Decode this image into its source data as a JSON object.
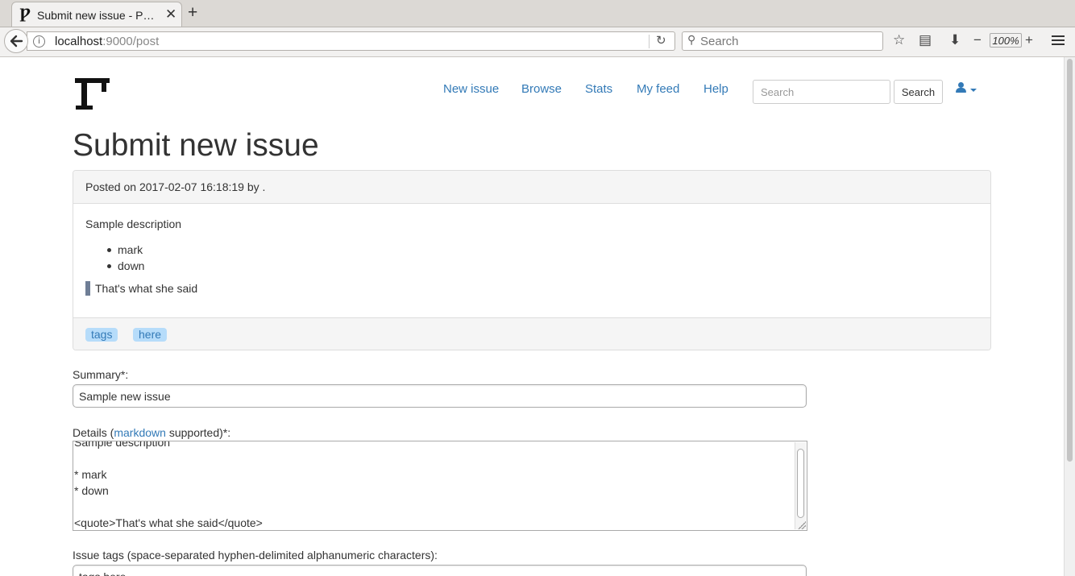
{
  "browser": {
    "tab_title": "Submit new issue - P…",
    "tab_favicon": "Ƿ",
    "url_host": "localhost",
    "url_rest": ":9000/post",
    "search_placeholder": "Search",
    "zoom": "100%"
  },
  "header": {
    "nav": [
      "New issue",
      "Browse",
      "Stats",
      "My feed",
      "Help"
    ],
    "search_placeholder": "Search",
    "search_button": "Search"
  },
  "page": {
    "title": "Submit new issue"
  },
  "preview": {
    "posted": "Posted on 2017-02-07 16:18:19 by .",
    "description": "Sample description",
    "bullets": [
      "mark",
      "down"
    ],
    "quote": "That's what she said",
    "tags": [
      "tags",
      "here"
    ]
  },
  "form": {
    "summary_label": "Summary*:",
    "summary_value": "Sample new issue",
    "details_label_prefix": "Details (",
    "details_label_link": "markdown",
    "details_label_suffix": " supported)*:",
    "details_value": "Sample description\n\n* mark\n* down\n\n<quote>That's what she said</quote>",
    "tags_label": "Issue tags (space-separated hyphen-delimited alphanumeric characters):",
    "tags_value": "tags here"
  }
}
